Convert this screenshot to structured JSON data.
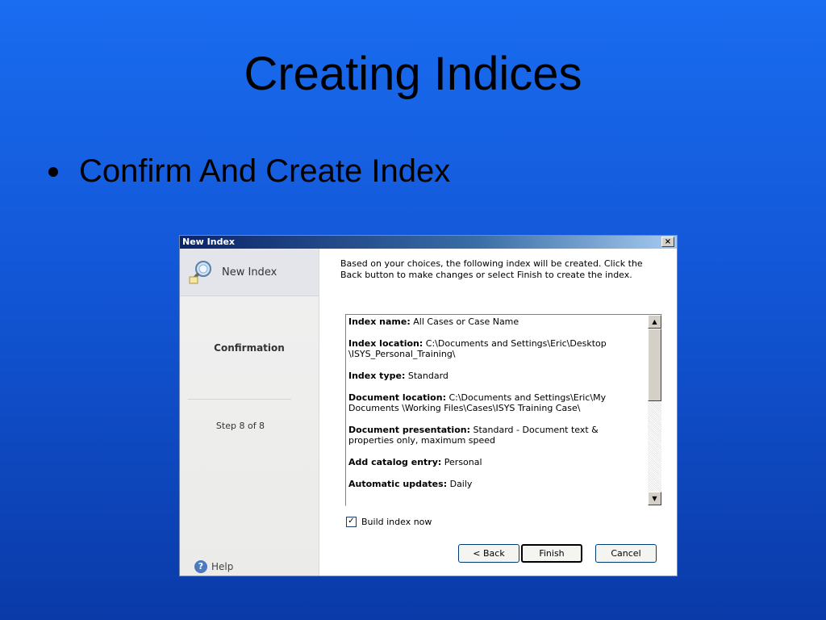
{
  "slide": {
    "title": "Creating Indices",
    "bullet": "Confirm And Create Index"
  },
  "dialog": {
    "title": "New Index",
    "close_label": "×",
    "sidebar": {
      "header": "New Index",
      "step_name": "Confirmation",
      "step_count": "Step 8 of 8",
      "help_label": "Help"
    },
    "intro": "Based on your choices, the following index will be created. Click the Back button to make changes or select Finish to create the index.",
    "summary": [
      {
        "key": "Index name:",
        "value": "All Cases or Case Name"
      },
      {
        "key": "Index location:",
        "value": "C:\\Documents and Settings\\Eric\\Desktop \\ISYS_Personal_Training\\"
      },
      {
        "key": "Index type:",
        "value": "Standard"
      },
      {
        "key": "Document location:",
        "value": "C:\\Documents and Settings\\Eric\\My Documents \\Working Files\\Cases\\ISYS Training Case\\"
      },
      {
        "key": "Document presentation:",
        "value": "Standard - Document text & properties only, maximum speed"
      },
      {
        "key": "Add catalog entry:",
        "value": "Personal"
      },
      {
        "key": "Automatic updates:",
        "value": "Daily"
      }
    ],
    "checkbox": {
      "label": "Build index now",
      "checked": true
    },
    "buttons": {
      "back": "< Back",
      "finish": "Finish",
      "cancel": "Cancel"
    }
  },
  "colors": {
    "background_top": "#1a6cf0",
    "background_bottom": "#0a3aa8",
    "titlebar": "#0a246a"
  }
}
